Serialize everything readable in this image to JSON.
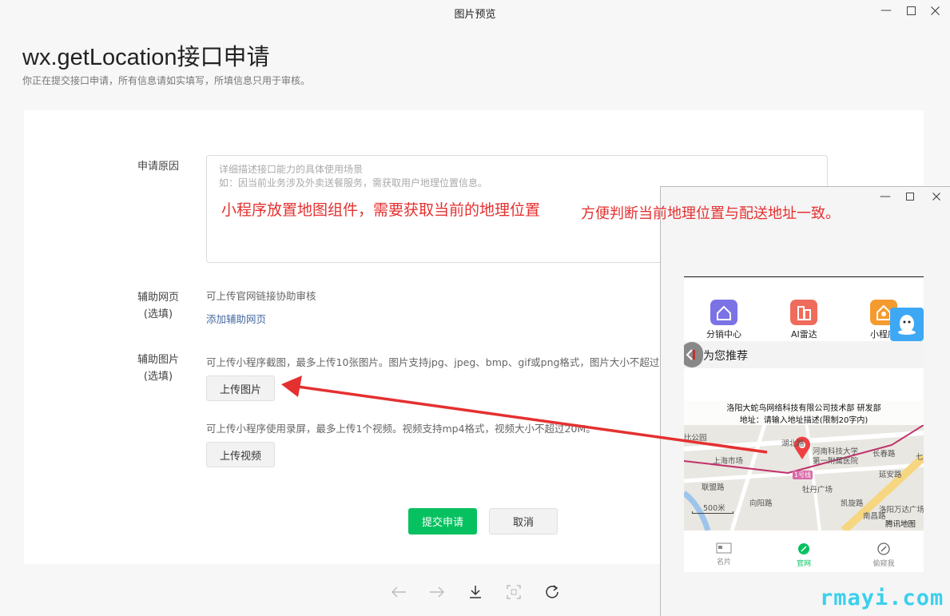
{
  "window": {
    "title": "图片预览"
  },
  "header": {
    "title": "wx.getLocation接口申请",
    "subtitle": "你正在提交接口申请，所有信息请如实填写，所填信息只用于审核。"
  },
  "form": {
    "reason_label": "申请原因",
    "reason_placeholder_line1": "详细描述接口能力的具体使用场景",
    "reason_placeholder_line2": "如：因当前业务涉及外卖送餐服务，需获取用户地理位置信息。",
    "webpage_label": "辅助网页",
    "webpage_optional": "(选填)",
    "webpage_hint": "可上传官网链接协助审核",
    "webpage_link": "添加辅助网页",
    "image_label": "辅助图片",
    "image_optional": "(选填)",
    "image_hint": "可上传小程序截图，最多上传10张图片。图片支持jpg、jpeg、bmp、gif或png格式，图片大小不超过",
    "upload_image": "上传图片",
    "video_hint": "可上传小程序使用录屏，最多上传1个视频。视频支持mp4格式，视频大小不超过20M。",
    "upload_video": "上传视频",
    "submit": "提交申请",
    "cancel": "取消"
  },
  "annotations": {
    "text1": "小程序放置地图组件，需要获取当前的地理位置",
    "text2": "方便判断当前地理位置与配送地址一致。"
  },
  "phone": {
    "grid": [
      {
        "label": "分销中心",
        "color": "#7b72e6"
      },
      {
        "label": "AI雷达",
        "color": "#ef6b5b"
      },
      {
        "label": "小程序",
        "color": "#f59a2f"
      }
    ],
    "recommend_title": "为您推荐",
    "map_card_line1": "洛阳大蛇鸟网络科技有限公司技术部 研发部",
    "map_card_line2": "地址：请输入地址描述(限制20字内)",
    "map_labels": {
      "a": "湖北路",
      "b": "河南科技大学",
      "c": "第一附属医院",
      "d": "上海市场",
      "e": "长春路",
      "f": "牡丹广场",
      "g": "联盟路",
      "h": "延安路",
      "i": "向阳路",
      "j": "南昌路",
      "k": "洛阳万达广场",
      "l": "凯旋路",
      "m": "1号线",
      "n": "七",
      "o": "比公园"
    },
    "scale": "500米",
    "map_brand": "腾讯地图",
    "tabs": [
      "名片",
      "官网",
      "偷窥我"
    ]
  },
  "watermark": "rmayi.com"
}
